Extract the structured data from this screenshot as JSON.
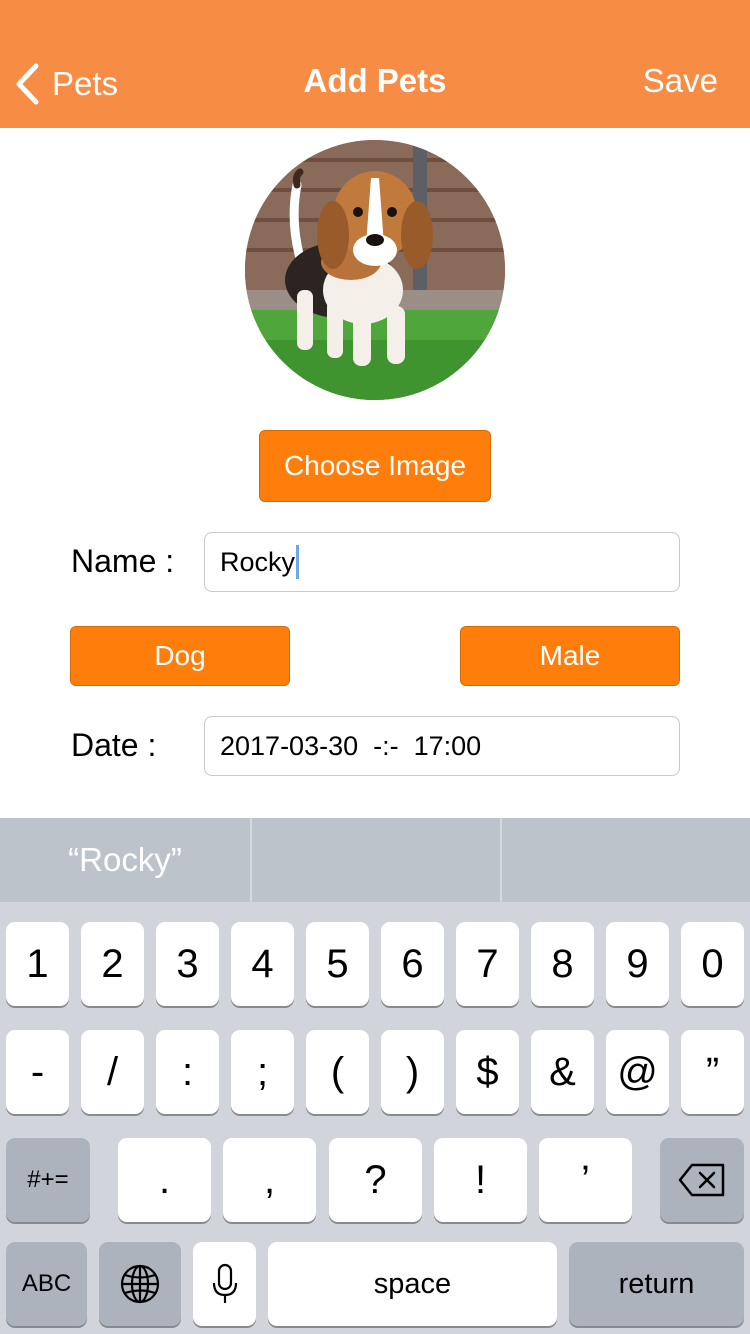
{
  "nav": {
    "back_label": "Pets",
    "title": "Add Pets",
    "save_label": "Save"
  },
  "form": {
    "choose_image_label": "Choose Image",
    "name_label": "Name :",
    "name_value": "Rocky",
    "species_button": "Dog",
    "gender_button": "Male",
    "date_label": "Date :",
    "date_value": "2017-03-30  -:-  17:00"
  },
  "keyboard": {
    "suggestions": [
      "“Rocky”",
      "",
      ""
    ],
    "row1": [
      "1",
      "2",
      "3",
      "4",
      "5",
      "6",
      "7",
      "8",
      "9",
      "0"
    ],
    "row2": [
      "-",
      "/",
      ":",
      ";",
      "(",
      ")",
      "$",
      "&",
      "@",
      "”"
    ],
    "row3": [
      "#+=",
      ".",
      ",",
      "?",
      "!",
      "’"
    ],
    "row4": {
      "abc": "ABC",
      "space": "space",
      "return": "return"
    }
  },
  "colors": {
    "nav_background": "#F78C45",
    "button_orange": "#FF7E0B",
    "keyboard_background": "#D1D5DB"
  },
  "icons": [
    "back-chevron-icon",
    "backspace-icon",
    "globe-icon",
    "microphone-icon"
  ]
}
